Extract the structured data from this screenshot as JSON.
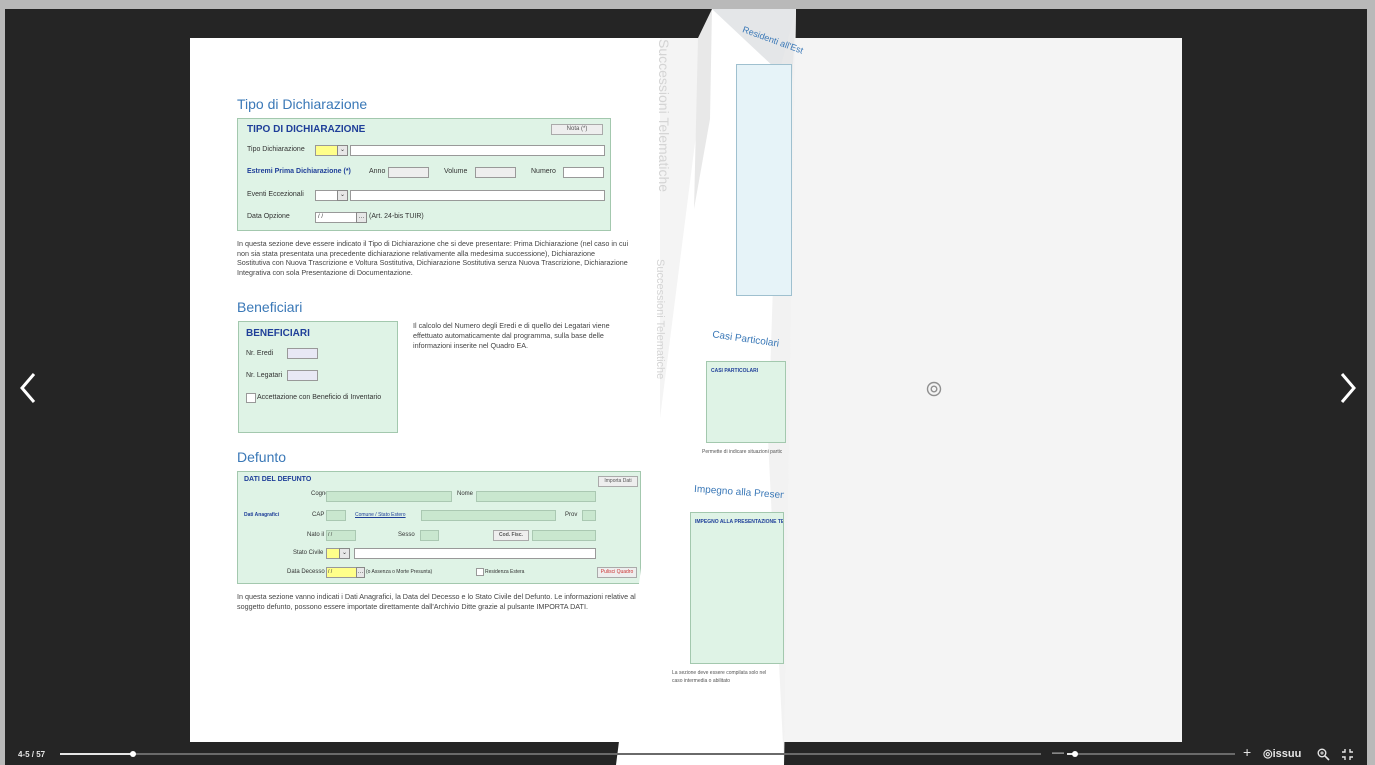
{
  "viewer": {
    "page_counter": "4-5 / 57",
    "progress": 0.074,
    "zoom_level": 0.05,
    "brand": "issuu",
    "zoom_out": "—",
    "zoom_in": "+"
  },
  "left_page": {
    "sec1_title": "Tipo di Dichiarazione",
    "form1": {
      "title": "TIPO DI DICHIARAZIONE",
      "nota_button": "Nota (*)",
      "tipo_label": "Tipo Dichiarazione",
      "estremi_label": "Estremi Prima Dichiarazione (*)",
      "anno_label": "Anno",
      "volume_label": "Volume",
      "numero_label": "Numero",
      "eventi_label": "Eventi Eccezionali",
      "data_opzione_label": "Data Opzione",
      "data_opzione_value": "/ /",
      "art_label": "(Art. 24-bis TUIR)"
    },
    "sec1_text": "In questa sezione deve essere indicato il Tipo di Dichiarazione che si deve presentare: Prima Dichiarazione (nel caso in cui non sia stata presentata una precedente dichiarazione relativamente alla medesima successione), Dichiarazione Sostitutiva con Nuova Trascrizione e Voltura Sostitutiva, Dichiarazione Sostitutiva senza Nuova Trascrizione, Dichiarazione Integrativa con sola Presentazione di Documentazione.",
    "sec2_title": "Beneficiari",
    "form2": {
      "title": "BENEFICIARI",
      "eredi_label": "Nr. Eredi",
      "legatari_label": "Nr. Legatari",
      "beneficio_label": "Accettazione con Beneficio di Inventario"
    },
    "sec2_text": "Il calcolo del Numero degli Eredi e di quello dei Legatari viene effettuato automaticamente dal programma, sulla base delle informazioni inserite nel Quadro EA.",
    "sec3_title": "Defunto",
    "form3": {
      "title": "DATI DEL DEFUNTO",
      "importa_button": "Importa Dati",
      "cognome_label": "Cognome",
      "nome_label": "Nome",
      "dati_anagrafici_label": "Dati Anagrafici",
      "cap_label": "CAP",
      "comune_link": "Comune / Stato Estero",
      "prov_label": "Prov",
      "nato_label": "Nato il",
      "nato_value": "/ /",
      "sesso_label": "Sesso",
      "cod_fisc_button": "Cod. Fisc.",
      "stato_civile_label": "Stato Civile",
      "data_decesso_label": "Data Decesso",
      "data_decesso_value": "/ /",
      "assenza_label": "(o Assenza o Morte Presunta)",
      "residenza_label": "Residenza Estera",
      "pulisci_button": "Pulisci Quadro"
    },
    "sec3_text": "In questa sezione vanno indicati i Dati Anagrafici, la Data del Decesso e lo Stato Civile del Defunto. Le informazioni relative al soggetto defunto, possono essere importate direttamente dall'Archivio Ditte grazie al pulsante IMPORTA DATI."
  },
  "curl_page": {
    "watermark_1": "Successioni Telematiche",
    "watermark_2": "Successioni Telematiche",
    "h_residenti": "Residenti all'Est",
    "h_casi": "Casi Particolari",
    "form_casi_title": "CASI PARTICOLARI",
    "text_casi": "Permette di indicare situazioni partic",
    "h_impegno": "Impegno alla Presentazion",
    "form_impegno_title": "IMPEGNO ALLA PRESENTAZIONE TEL",
    "text_impegno": "La sezione deve essere compilata solo nel caso intermedia o abilitato"
  },
  "colors": {
    "accent_blue": "#3a78b7",
    "form_bg": "#dff3e6",
    "form_title": "#1f3f99",
    "viewer_bg": "#252525"
  },
  "icons": {
    "prev": "chevron-left-icon",
    "next": "chevron-right-icon",
    "center": "target-icon",
    "zoom": "magnifier-plus-icon",
    "fullscreen": "fullscreen-icon"
  }
}
